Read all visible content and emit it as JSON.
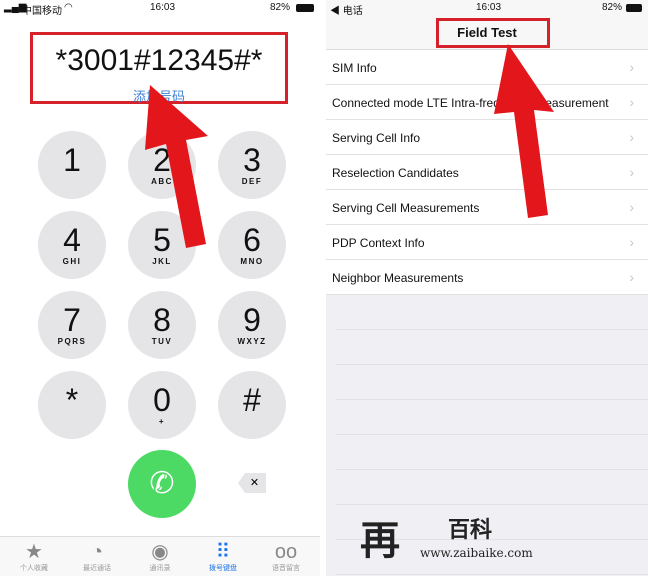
{
  "left": {
    "status": {
      "carrier": "中国移动",
      "time": "16:03",
      "battery": "82%"
    },
    "dialed_number": "*3001#12345#*",
    "add_number_label": "添加号码",
    "keys": [
      {
        "digit": "1",
        "letters": ""
      },
      {
        "digit": "2",
        "letters": "ABC"
      },
      {
        "digit": "3",
        "letters": "DEF"
      },
      {
        "digit": "4",
        "letters": "GHI"
      },
      {
        "digit": "5",
        "letters": "JKL"
      },
      {
        "digit": "6",
        "letters": "MNO"
      },
      {
        "digit": "7",
        "letters": "PQRS"
      },
      {
        "digit": "8",
        "letters": "TUV"
      },
      {
        "digit": "9",
        "letters": "WXYZ"
      },
      {
        "digit": "*",
        "letters": ""
      },
      {
        "digit": "0",
        "letters": "+"
      },
      {
        "digit": "#",
        "letters": ""
      }
    ],
    "tabs": [
      {
        "label": "个人收藏",
        "icon": "star-icon"
      },
      {
        "label": "最近通话",
        "icon": "clock-icon"
      },
      {
        "label": "通讯录",
        "icon": "contacts-icon"
      },
      {
        "label": "拨号键盘",
        "icon": "keypad-icon",
        "active": true
      },
      {
        "label": "语音留言",
        "icon": "voicemail-icon"
      }
    ]
  },
  "right": {
    "status": {
      "back": "◀ 电话",
      "time": "16:03",
      "battery": "82%"
    },
    "title": "Field Test",
    "items": [
      "SIM Info",
      "Connected mode LTE Intra-frequency Measurement",
      "Serving Cell Info",
      "Reselection Candidates",
      "Serving Cell Measurements",
      "PDP Context Info",
      "Neighbor Measurements"
    ]
  },
  "watermark": {
    "text": "百科",
    "url": "www.zaibaike.com"
  },
  "colors": {
    "highlight": "#d5222a",
    "call": "#4cd964",
    "accent": "#1a73e8"
  }
}
